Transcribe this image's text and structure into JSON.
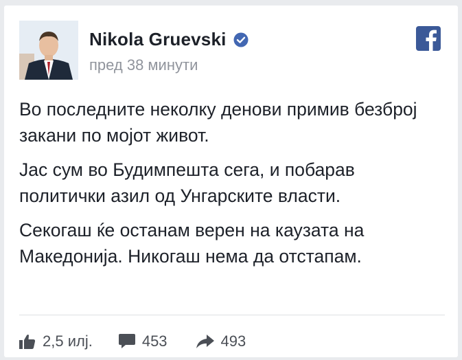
{
  "post": {
    "author": "Nikola Gruevski",
    "timestamp": "пред 38 минути",
    "paragraphs": [
      "Во последните неколку денови примив безброј закани по мојот живот.",
      "Јас сум во Будимпешта сега, и побарав политички азил од Унгарските власти.",
      "Секогаш ќе останам верен на каузата на Македонија. Никогаш нема да отстапам."
    ]
  },
  "stats": {
    "likes": "2,5 илј.",
    "comments": "453",
    "shares": "493"
  },
  "colors": {
    "facebook_blue": "#3b5998",
    "verified_blue": "#4267b2",
    "text": "#1d2129",
    "muted": "#90949c"
  },
  "icons": {
    "verified": "verified-badge-icon",
    "facebook": "facebook-logo-icon",
    "like": "thumbs-up-icon",
    "comment": "comment-bubble-icon",
    "share": "share-arrow-icon"
  }
}
